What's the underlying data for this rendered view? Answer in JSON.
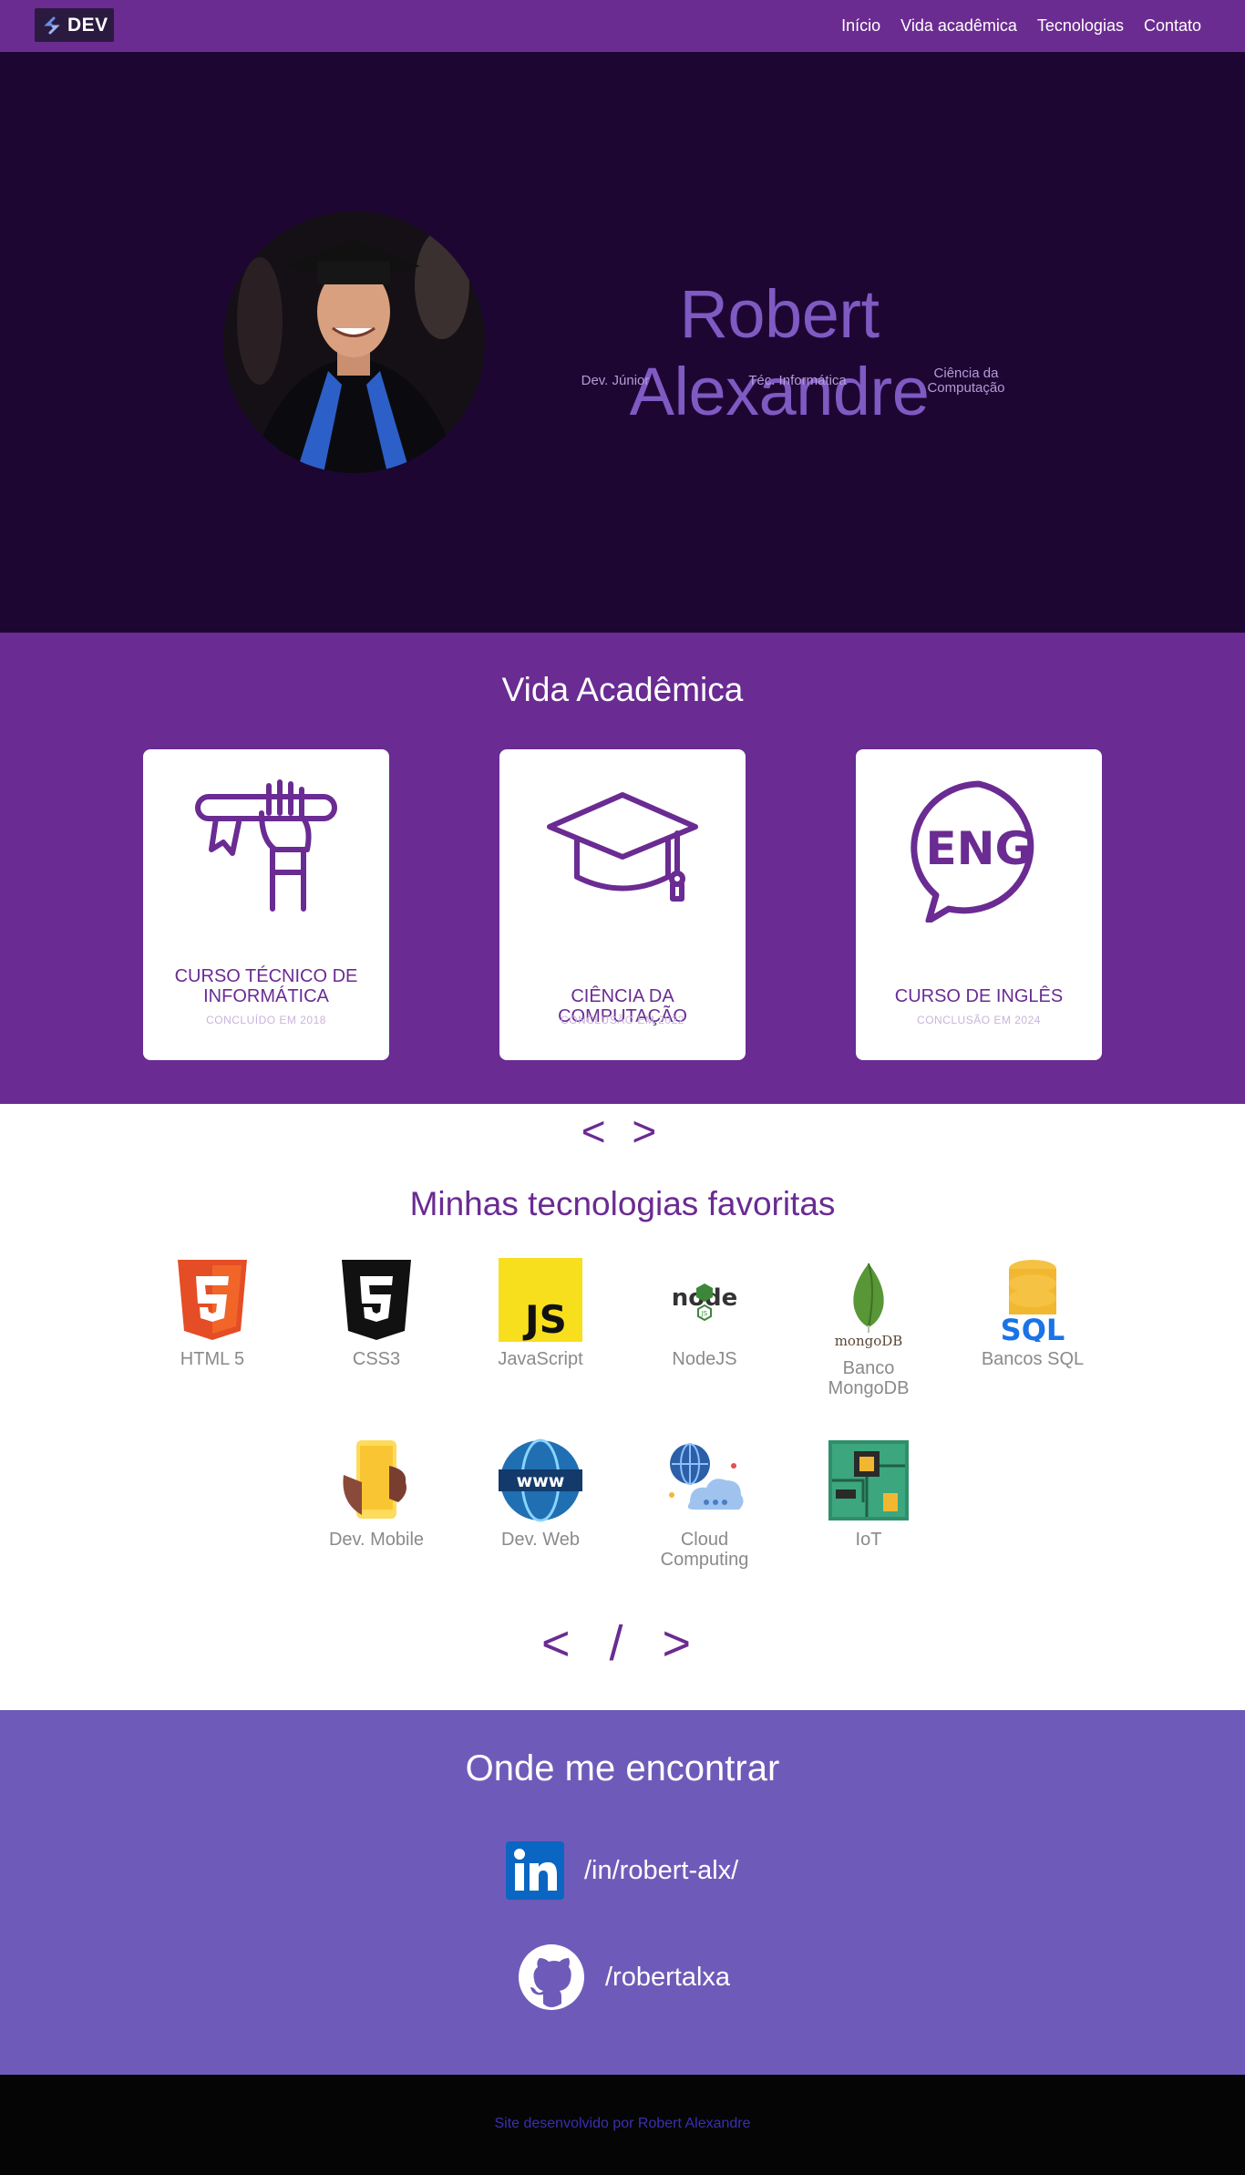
{
  "nav": {
    "brand": "DEV",
    "links": [
      "Início",
      "Vida acadêmica",
      "Tecnologias",
      "Contato"
    ]
  },
  "hero": {
    "name": "Robert Alexandre",
    "tags": [
      "Dev. Júnior",
      "Téc. Informática",
      "Ciência da Computação"
    ]
  },
  "academic": {
    "title": "Vida Acadêmica",
    "cards": [
      {
        "title": "CURSO TÉCNICO DE INFORMÁTICA",
        "sub": "CONCLUÍDO EM 2018",
        "icon": "diploma-hand-icon"
      },
      {
        "title": "CIÊNCIA DA COMPUTAÇÃO",
        "sub": "CONCLUSÃO EM 2022",
        "icon": "graduation-cap-icon"
      },
      {
        "title": "CURSO DE INGLÊS",
        "sub": "CONCLUSÃO EM 2024",
        "icon": "eng-speech-bubble-icon"
      }
    ],
    "divider": "< >"
  },
  "tech": {
    "title": "Minhas tecnologias favoritas",
    "items": [
      {
        "label": "HTML 5",
        "icon": "html5-icon"
      },
      {
        "label": "CSS3",
        "icon": "css3-icon"
      },
      {
        "label": "JavaScript",
        "icon": "javascript-icon"
      },
      {
        "label": "NodeJS",
        "icon": "nodejs-icon"
      },
      {
        "label": "Banco MongoDB",
        "icon": "mongodb-icon"
      },
      {
        "label": "Bancos SQL",
        "icon": "sql-icon"
      },
      {
        "label": "Dev. Mobile",
        "icon": "mobile-icon"
      },
      {
        "label": "Dev. Web",
        "icon": "www-icon"
      },
      {
        "label": "Cloud Computing",
        "icon": "cloud-icon"
      },
      {
        "label": "IoT",
        "icon": "circuit-board-icon"
      }
    ],
    "divider": "< / >"
  },
  "contact": {
    "title": "Onde me encontrar",
    "linkedin": "/in/robert-alx/",
    "github": "/robertalxa"
  },
  "footer": {
    "text": "Site desenvolvido por Robert Alexandre"
  },
  "colors": {
    "nav": "#6b2c91",
    "hero": "#1e0633",
    "academic": "#6a2b92",
    "contact": "#6e5bb9",
    "footer": "#050505"
  }
}
